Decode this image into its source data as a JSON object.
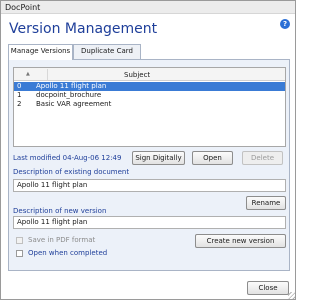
{
  "window": {
    "title": "DocPoint"
  },
  "header": {
    "title": "Version Management",
    "help_icon": "help-icon",
    "help_glyph": "?"
  },
  "tabs": [
    {
      "label": "Manage Versions",
      "active": true
    },
    {
      "label": "Duplicate Card",
      "active": false
    }
  ],
  "versions_list": {
    "columns": [
      "Subject"
    ],
    "sort_indicator": "▲",
    "rows": [
      {
        "index": "0",
        "subject": "Apollo 11 flight plan",
        "selected": true
      },
      {
        "index": "1",
        "subject": "docpoint_brochure",
        "selected": false
      },
      {
        "index": "2",
        "subject": "Basic VAR agreement",
        "selected": false
      }
    ]
  },
  "status": {
    "last_modified": "Last modified  04-Aug-06  12:49"
  },
  "actions": {
    "sign_digitally": "Sign Digitally",
    "open": "Open",
    "delete": "Delete",
    "rename": "Rename",
    "create_new_version": "Create new version",
    "close": "Close"
  },
  "existing_document": {
    "label": "Description of existing document",
    "value": "Apollo 11 flight plan"
  },
  "new_version": {
    "label": "Description of new version",
    "value": "Apollo 11 flight plan"
  },
  "options": {
    "save_pdf": {
      "label": "Save in PDF format",
      "checked": false,
      "enabled": false
    },
    "open_when_completed": {
      "label": "Open when completed",
      "checked": false,
      "enabled": true
    }
  },
  "colors": {
    "accent": "#1f3f9a",
    "selection": "#3a7bd5",
    "panel": "#ecf1f9"
  }
}
